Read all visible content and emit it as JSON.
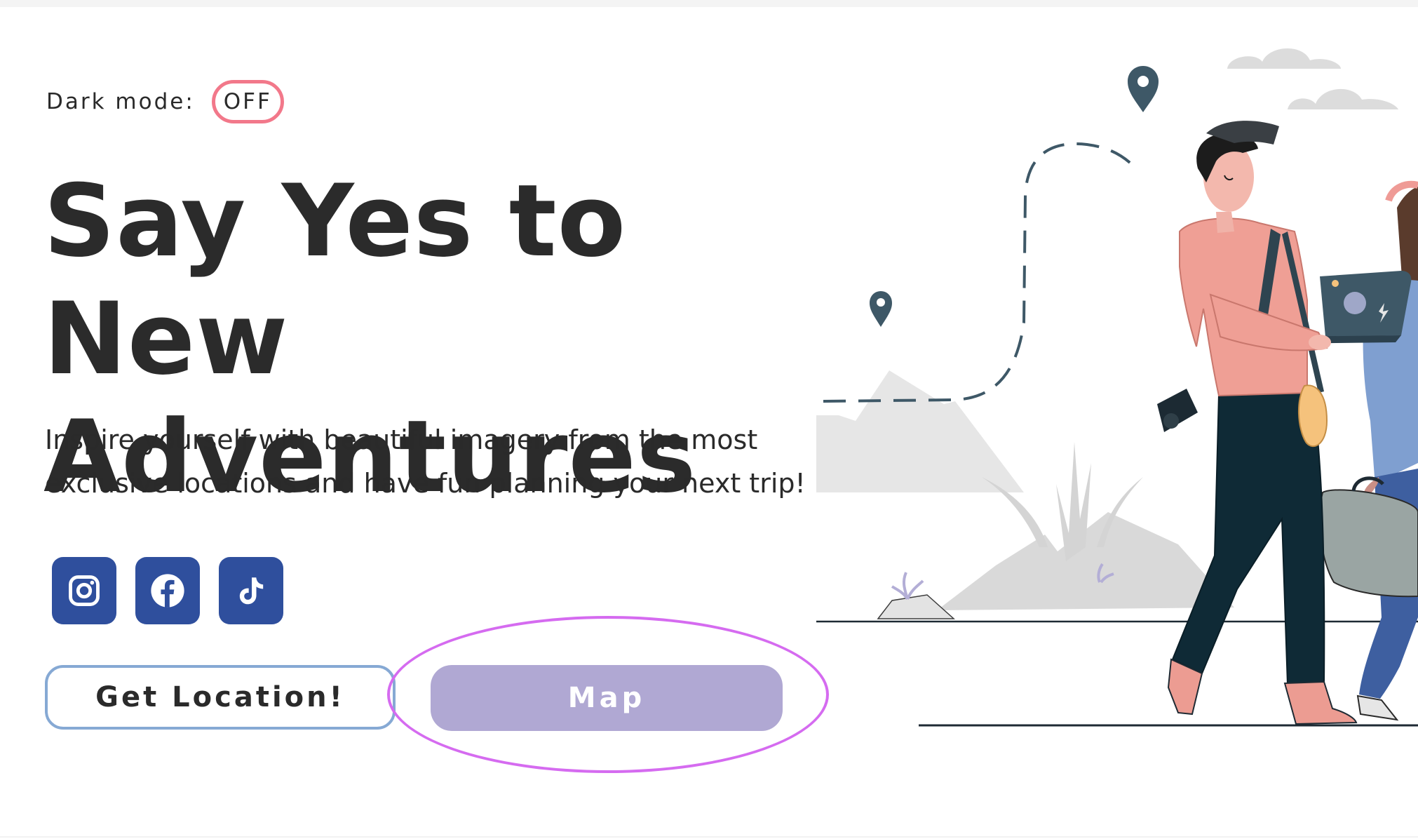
{
  "dark_mode": {
    "label": "Dark mode:",
    "state": "OFF"
  },
  "hero": {
    "title_line1": "Say Yes to New",
    "title_line2": "Adventures",
    "description_line1": "Inspire yourself with beautiful imagery from the most",
    "description_line2": "exclusive locations and have fun planning your next trip!"
  },
  "social": [
    {
      "icon": "instagram-icon"
    },
    {
      "icon": "facebook-icon"
    },
    {
      "icon": "tiktok-icon"
    }
  ],
  "actions": {
    "get_location": "Get Location!",
    "map": "Map"
  },
  "colors": {
    "accent_social": "#2f4f9d",
    "toggle_border": "#f2788a",
    "get_location_border": "#86a9d4",
    "map_button": "#b0a8d3",
    "map_highlight": "#d56bf0"
  }
}
